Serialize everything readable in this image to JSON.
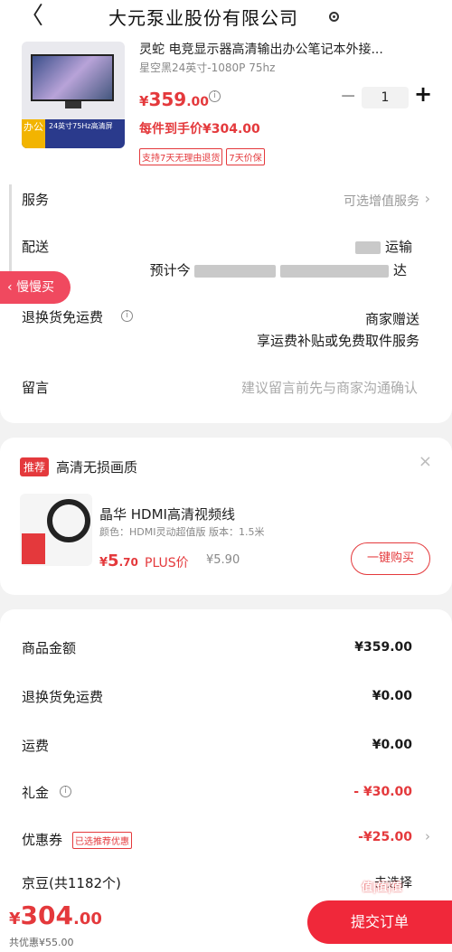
{
  "header": {
    "back_glyph": "〈",
    "title": "大元泵业股份有限公司",
    "location_icon": "location-pin-icon"
  },
  "product": {
    "name": "灵蛇 电竞显示器高清输出办公笔记本外接...",
    "spec": "星空黑24英寸-1080P 75hz",
    "price_currency": "¥",
    "price_int": "359",
    "price_dec": ".00",
    "info_glyph": "i",
    "qty": "1",
    "final_price": "每件到手价¥304.00",
    "tags": [
      "支持7天无理由退货",
      "7天价保"
    ],
    "thumb_tag": "办公",
    "thumb_text": "24英寸75Hz高清屏"
  },
  "rows": {
    "service_label": "服务",
    "service_value": "可选增值服务",
    "delivery_label": "配送",
    "delivery_line1": "运输",
    "delivery_line2a": "预计今",
    "delivery_line2b": "达",
    "return_label": "退换货免运费",
    "return_value1": "商家赠送",
    "return_value2": "享运费补贴或免费取件服务",
    "note_label": "留言",
    "note_placeholder": "建议留言前先与商家沟通确认"
  },
  "slow_buy": "慢慢买",
  "recommend": {
    "badge": "推荐",
    "title": "高清无损画质",
    "close": "×",
    "name": "晶华 HDMI高清视频线",
    "spec": "颜色：HDMI灵动超值版  版本：1.5米",
    "price_currency": "¥",
    "price_int": "5",
    "price_dec": ".70",
    "plus_label": "PLUS价",
    "plus_price": "¥5.90",
    "buy_label": "一键购买"
  },
  "summary": [
    {
      "label": "商品金额",
      "value": "¥359.00"
    },
    {
      "label": "退换货免运费",
      "value": "¥0.00"
    },
    {
      "label": "运费",
      "value": "¥0.00"
    },
    {
      "label": "礼金",
      "value": "- ¥30.00"
    },
    {
      "label": "优惠券",
      "value": "-¥25.00",
      "tag": "已选推荐优惠"
    },
    {
      "label": "京豆(共1182个)",
      "value": "去选择"
    }
  ],
  "footer": {
    "currency": "¥",
    "total_int": "304",
    "total_dec": ".00",
    "saving": "共优惠¥55.00",
    "submit": "提交订单",
    "watermark": "值|值|值"
  }
}
